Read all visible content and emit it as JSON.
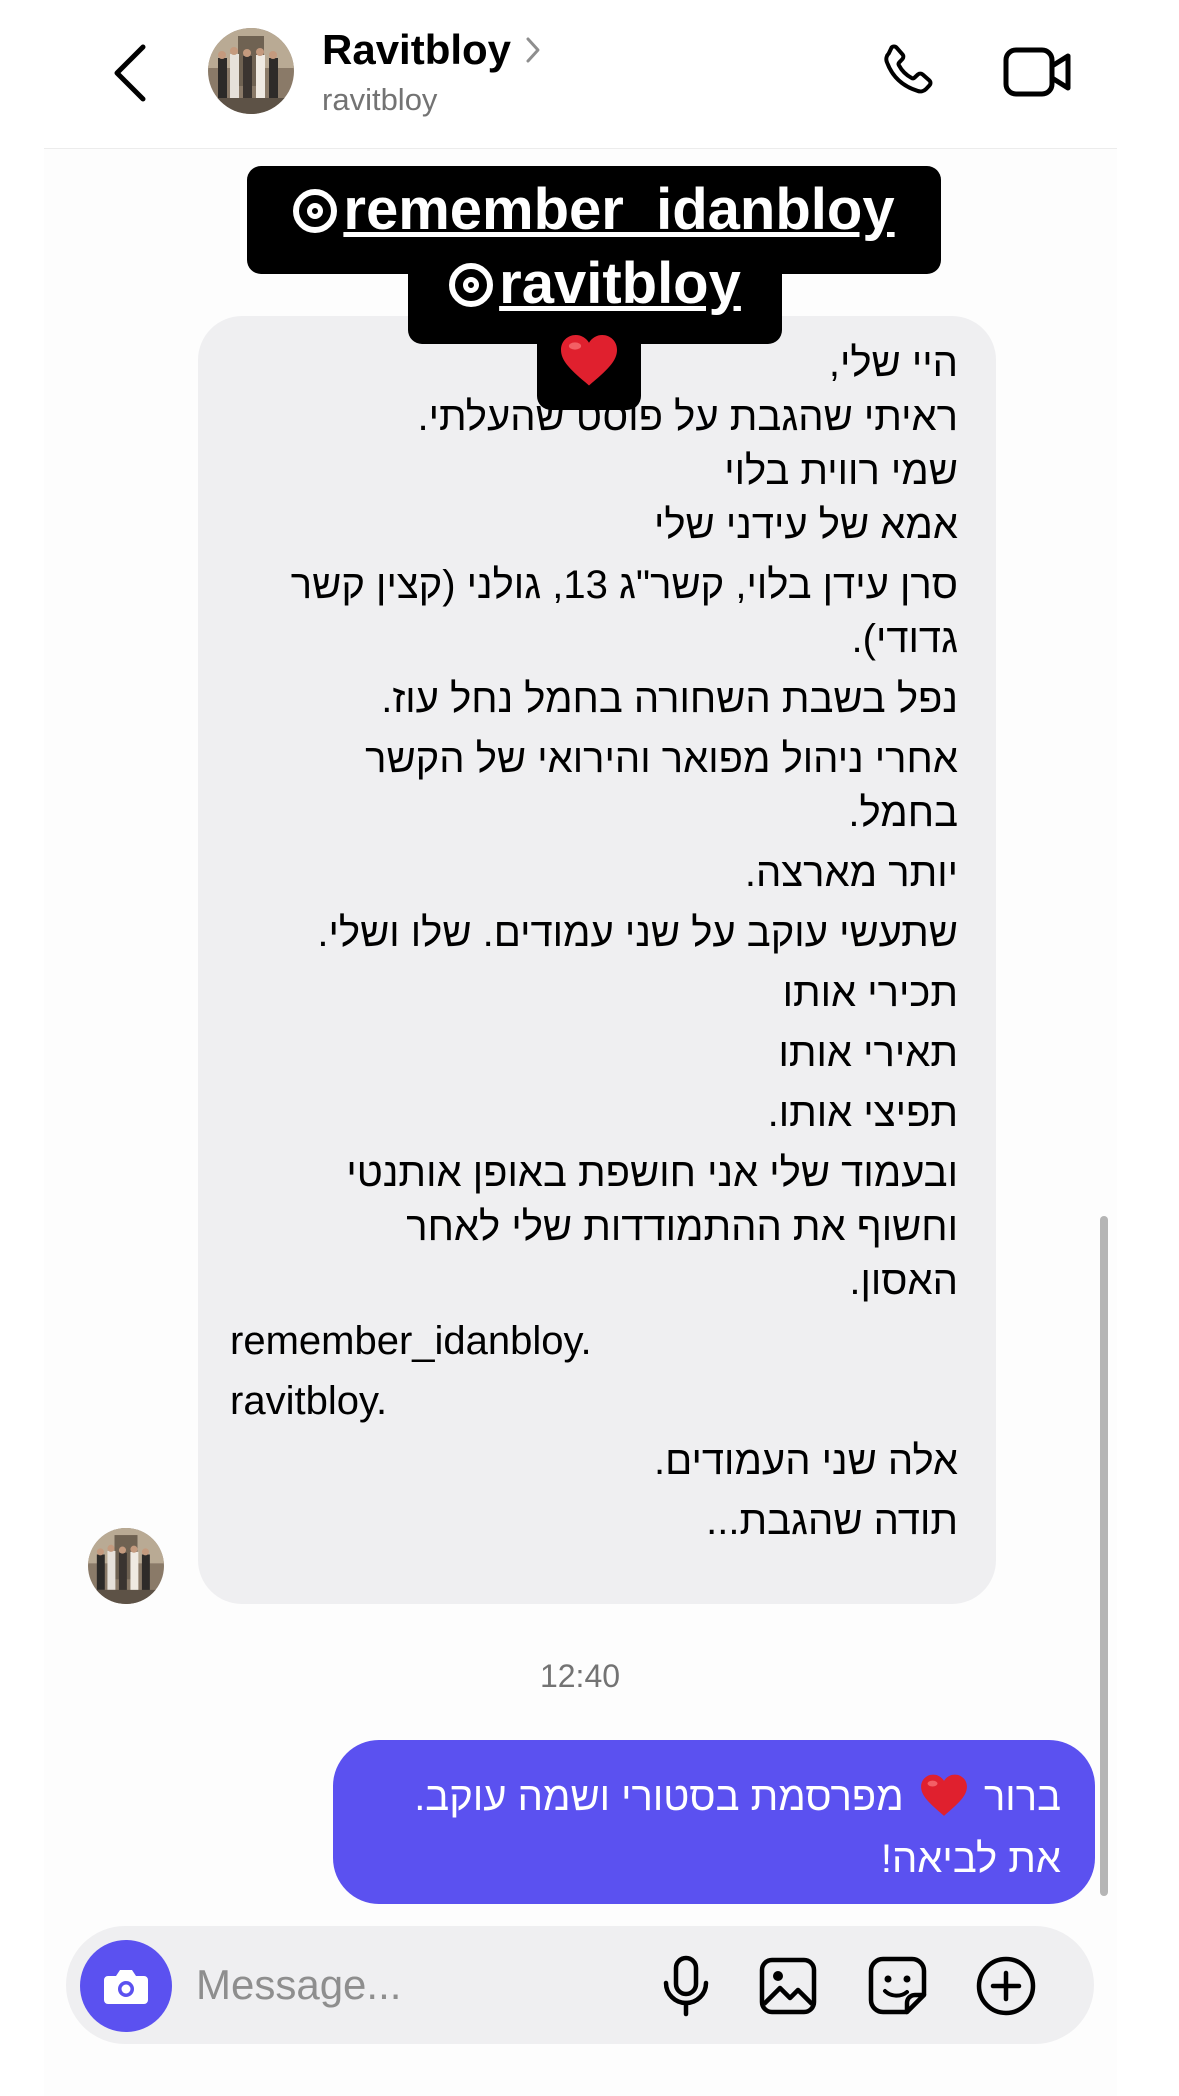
{
  "header": {
    "display_name": "Ravitbloy",
    "username": "ravitbloy"
  },
  "story_reply": {
    "sticker_line1": "remember_idanbloy",
    "sticker_line2": "ravitbloy"
  },
  "received_message": {
    "lines": [
      "היי שלי,",
      "ראיתי שהגבת על פוסט שהעלתי.",
      "שמי רווית בלוי",
      "אמא של עידני שלי",
      "סרן עידן בלוי, קשר\"ג 13, גולני (קצין קשר",
      "גדודי).",
      "נפל בשבת השחורה בחמל נחל עוז.",
      "אחרי ניהול מפואר והירואי של הקשר",
      "בחמל.",
      "יותר מארצה.",
      "שתעשי עוקב על שני עמודים. שלו ושלי.",
      "תכירי אותו",
      "תאירי אותו",
      "תפיצי אותו.",
      "ובעמוד שלי אני חושפת באופן אותנטי",
      "וחשוף את ההתמודדות שלי לאחר",
      "האסון.",
      "remember_idanbloy.",
      "ravitbloy.",
      "אלה שני העמודים.",
      "תודה שהגבת..."
    ]
  },
  "timestamp": "12:40",
  "sent_message": {
    "line1_before_heart": "ברור",
    "line1_after_heart": "מפרסמת בסטורי ושמה עוקב.",
    "line2": "את לביאה!"
  },
  "composer": {
    "placeholder": "Message..."
  },
  "icons": {
    "back": "chevron-left-icon",
    "call": "phone-icon",
    "video": "video-camera-icon",
    "camera": "camera-icon",
    "mic": "microphone-icon",
    "gallery": "image-icon",
    "sticker": "sticker-icon",
    "plus": "plus-circle-icon",
    "heart": "red-heart-emoji"
  },
  "colors": {
    "accent": "#5b51f0",
    "received_bubble": "#efeff1",
    "secondary_text": "#737373",
    "heart": "#e0202e"
  }
}
